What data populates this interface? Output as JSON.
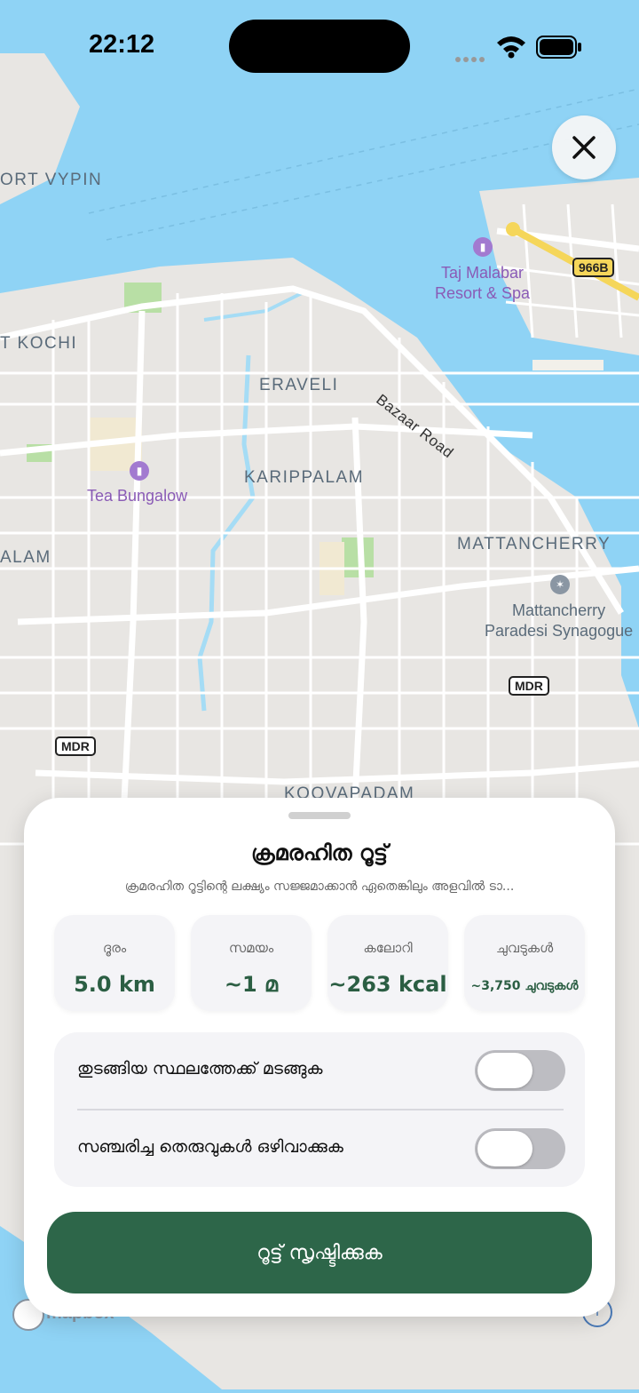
{
  "status": {
    "time": "22:12"
  },
  "map": {
    "labels": {
      "fort_vypin": "ORT VYPIN",
      "fort_kochi": "T KOCHI",
      "eraveli": "ERAVELI",
      "karippalam": "KARIPPALAM",
      "mattancherry": "MATTANCHERRY",
      "alam": "ALAM",
      "koovapadam": "KOOVAPADAM",
      "bazaar_road": "Bazaar Road"
    },
    "pois": {
      "taj": "Taj Malabar\nResort & Spa",
      "tea": "Tea Bungalow",
      "synagogue": "Mattancherry\nParadesi Synagogue"
    },
    "shields": {
      "s966b": "966B",
      "mdr1": "MDR",
      "mdr2": "MDR"
    },
    "attribution": "mapbox"
  },
  "sheet": {
    "title": "ക്രമരഹിത റൂട്ട്",
    "subtitle": "ക്രമരഹിത റൂട്ടിന്റെ ലക്ഷ്യം സജ്ജമാക്കാൻ ഏതെങ്കിലും അളവിൽ ടാ...",
    "stats": [
      {
        "label": "ദൂരം",
        "value": "5.0 km"
      },
      {
        "label": "സമയം",
        "value": "~1 മ"
      },
      {
        "label": "കലോറി",
        "value": "~263 kcal"
      },
      {
        "label": "ചുവടുകൾ",
        "value": "~3,750 ചുവടുകൾ"
      }
    ],
    "toggles": [
      {
        "label": "തുടങ്ങിയ സ്ഥലത്തേക്ക് മടങ്ങുക",
        "on": false
      },
      {
        "label": "സഞ്ചരിച്ച തെരുവുകൾ ഒഴിവാക്കുക",
        "on": false
      }
    ],
    "cta": "റൂട്ട് സൃഷ്ടിക്കുക"
  },
  "colors": {
    "accent": "#2d6649",
    "value_text": "#2b5e43",
    "water": "#8fd3f5"
  }
}
